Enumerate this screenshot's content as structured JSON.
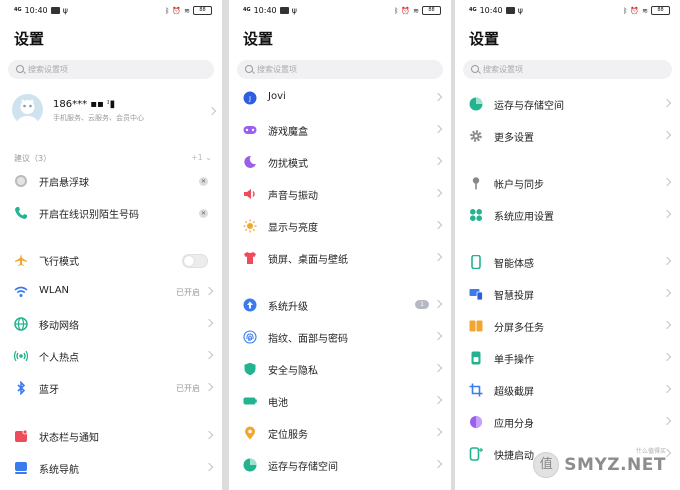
{
  "status": {
    "time": "10:40",
    "signal": "4G",
    "battery": "88"
  },
  "title": "设置",
  "search": {
    "placeholder": "搜索设置项"
  },
  "panel1": {
    "profile": {
      "name": "186*** ▪▪ ᶦ▮",
      "subtitle": "手机服务、云服务、会员中心"
    },
    "suggestions": {
      "header": "建议（3）",
      "count": "+1 ⌄"
    },
    "suggestion_items": [
      {
        "label": "开启悬浮球",
        "icon": "floating-ball-icon"
      },
      {
        "label": "开启在线识别陌生号码",
        "icon": "phone-icon"
      }
    ],
    "items": [
      {
        "label": "飞行模式",
        "icon": "airplane-icon",
        "value": ""
      },
      {
        "label": "WLAN",
        "icon": "wifi-icon",
        "value": "已开启"
      },
      {
        "label": "移动网络",
        "icon": "mobile-network-icon",
        "value": ""
      },
      {
        "label": "个人热点",
        "icon": "hotspot-icon",
        "value": ""
      },
      {
        "label": "蓝牙",
        "icon": "bluetooth-icon",
        "value": "已开启"
      },
      {
        "label": "状态栏与通知",
        "icon": "notification-icon",
        "value": ""
      },
      {
        "label": "系统导航",
        "icon": "navigation-icon",
        "value": ""
      }
    ]
  },
  "panel2": {
    "items": [
      {
        "label": "Jovi",
        "icon": "jovi-icon"
      },
      {
        "label": "游戏魔盒",
        "icon": "game-box-icon"
      },
      {
        "label": "勿扰模式",
        "icon": "moon-icon"
      },
      {
        "label": "声音与振动",
        "icon": "speaker-icon"
      },
      {
        "label": "显示与亮度",
        "icon": "sun-icon"
      },
      {
        "label": "锁屏、桌面与壁纸",
        "icon": "shirt-icon"
      },
      {
        "label": "系统升级",
        "icon": "upgrade-icon",
        "badge": "1"
      },
      {
        "label": "指纹、面部与密码",
        "icon": "fingerprint-icon"
      },
      {
        "label": "安全与隐私",
        "icon": "shield-icon"
      },
      {
        "label": "电池",
        "icon": "battery-icon"
      },
      {
        "label": "定位服务",
        "icon": "location-icon"
      },
      {
        "label": "运存与存储空间",
        "icon": "storage-icon"
      }
    ]
  },
  "panel3": {
    "items": [
      {
        "label": "运存与存储空间",
        "icon": "storage-icon"
      },
      {
        "label": "更多设置",
        "icon": "gear-icon"
      },
      {
        "label": "帐户与同步",
        "icon": "account-icon"
      },
      {
        "label": "系统应用设置",
        "icon": "apps-icon"
      },
      {
        "label": "智能体感",
        "icon": "smart-motion-icon"
      },
      {
        "label": "智慧投屏",
        "icon": "screen-cast-icon"
      },
      {
        "label": "分屏多任务",
        "icon": "split-screen-icon"
      },
      {
        "label": "单手操作",
        "icon": "one-hand-icon"
      },
      {
        "label": "超级截屏",
        "icon": "screenshot-icon"
      },
      {
        "label": "应用分身",
        "icon": "app-clone-icon"
      },
      {
        "label": "快捷启动",
        "icon": "quick-launch-icon"
      }
    ]
  },
  "watermark": {
    "text": "SMYZ.NET",
    "logo": "值",
    "sub": "什么值得买"
  }
}
